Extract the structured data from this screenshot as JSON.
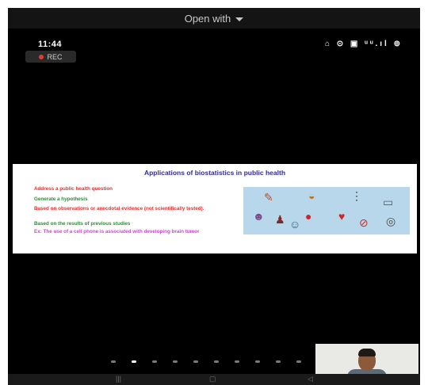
{
  "top_bar": {
    "open_with_label": "Open with"
  },
  "status_bar": {
    "time": "11:44",
    "icons_text": "⌂ ⊙ ▣ ᵘᵘ.ıl ⊚"
  },
  "rec_badge": {
    "label": "REC"
  },
  "slide": {
    "title": "Applications of biostatistics in public health",
    "bullets": [
      "Address a public health question",
      "Generate a hypothesis",
      "Based on observations or anecdotal evidence (not scientifically tested).",
      "Based on the results of previous studies",
      "Ex: The use of a cell phone is associated with developing brain tumor"
    ]
  },
  "colors": {
    "title": "#2f2aa0",
    "red_text": "#e0302e",
    "green_text": "#2e8b3a",
    "magenta_text": "#d13fd3",
    "collage_bg": "#b9d7ea"
  },
  "pager": {
    "count": 10,
    "active_index": 1
  },
  "nav_icons": [
    "recent-apps-icon",
    "home-icon",
    "back-icon"
  ],
  "collage_icons": [
    "syringe-icon",
    "burger-icon",
    "traffic-light-icon",
    "smoking-icon",
    "crowd-icon",
    "apple-icon",
    "heartbeat-icon",
    "no-smoking-icon",
    "doctor-icon",
    "scale-icon"
  ]
}
